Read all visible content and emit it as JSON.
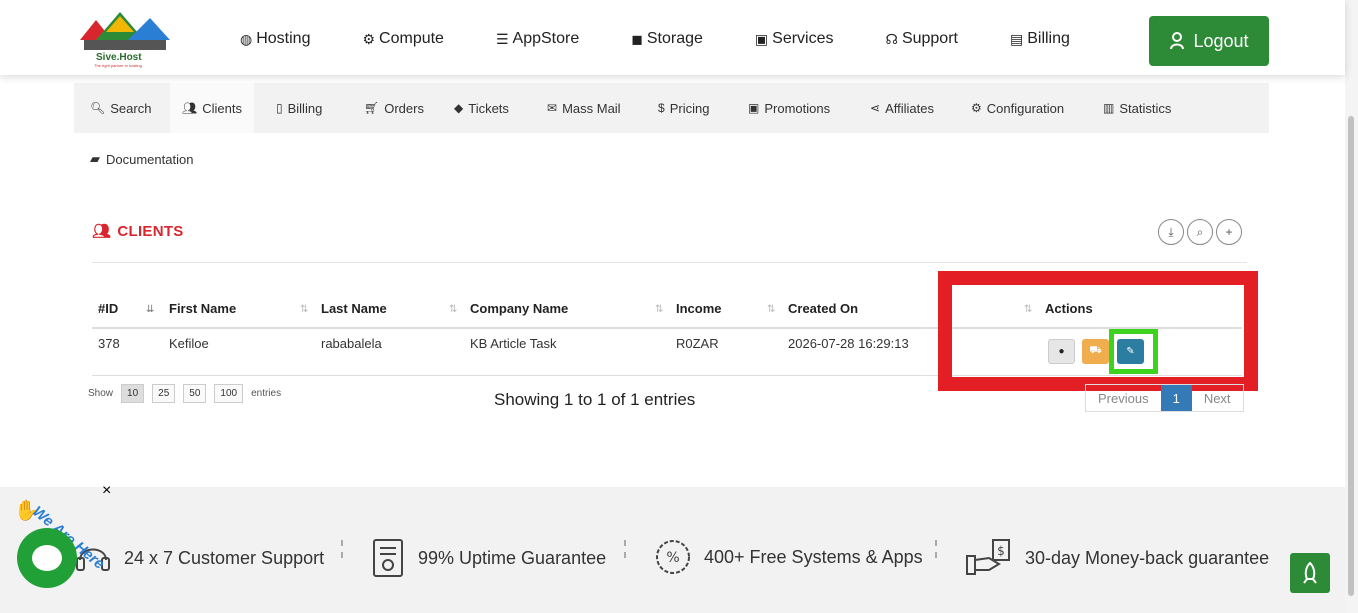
{
  "brand": {
    "name": "Sive.Host",
    "tagline": "The right partner in hosting"
  },
  "topnav": [
    {
      "label": "Hosting",
      "icon": "globe-icon"
    },
    {
      "label": "Compute",
      "icon": "gear-icon"
    },
    {
      "label": "AppStore",
      "icon": "database-icon"
    },
    {
      "label": "Storage",
      "icon": "cube-icon"
    },
    {
      "label": "Services",
      "icon": "gift-icon"
    },
    {
      "label": "Support",
      "icon": "headset-icon"
    },
    {
      "label": "Billing",
      "icon": "receipt-icon"
    }
  ],
  "logout_label": "Logout",
  "subnav": [
    {
      "label": "Search"
    },
    {
      "label": "Clients"
    },
    {
      "label": "Billing"
    },
    {
      "label": "Orders"
    },
    {
      "label": "Tickets"
    },
    {
      "label": "Mass Mail"
    },
    {
      "label": "Pricing"
    },
    {
      "label": "Promotions"
    },
    {
      "label": "Affiliates"
    },
    {
      "label": "Configuration"
    },
    {
      "label": "Statistics"
    }
  ],
  "documentation_label": "Documentation",
  "clients_title": "CLIENTS",
  "table": {
    "headers": [
      "#ID",
      "First Name",
      "Last Name",
      "Company Name",
      "Income",
      "Created On",
      "Actions"
    ],
    "rows": [
      {
        "id": "378",
        "first_name": "Kefiloe",
        "last_name": "rababalela",
        "company": "KB Article Task",
        "income": "R0ZAR",
        "created_on": "2026-07-28 16:29:13"
      }
    ]
  },
  "pagination": {
    "show_label": "Show",
    "entries_label": "entries",
    "lengths": [
      "10",
      "25",
      "50",
      "100"
    ],
    "info": "Showing 1 to 1 of 1 entries",
    "previous": "Previous",
    "current": "1",
    "next": "Next"
  },
  "features": [
    "24 x 7 Customer Support",
    "99% Uptime Guarantee",
    "400+ Free Systems & Apps",
    "30-day Money-back guarantee"
  ],
  "chat": {
    "label": "We Are Here",
    "close": "×"
  },
  "colors": {
    "brand_green": "#2d8a36",
    "accent_red": "#d9262e",
    "highlight_red": "#e31e24",
    "highlight_green": "#3dd21d",
    "pager_blue": "#337ab7"
  }
}
